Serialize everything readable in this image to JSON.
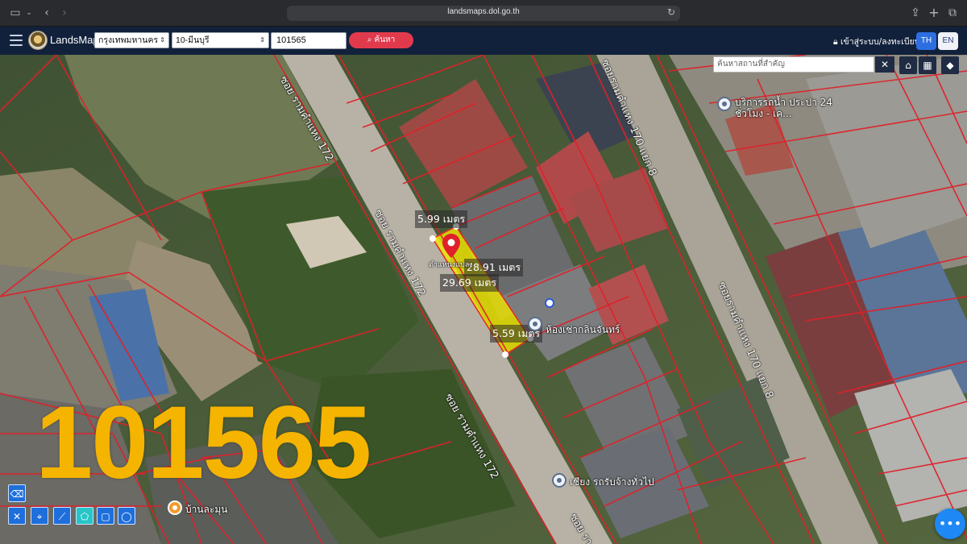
{
  "browser": {
    "url": "landsmaps.dol.go.th",
    "icons": [
      "sidebar-icon",
      "chevron-down-icon",
      "back-icon",
      "forward-icon",
      "reload-icon",
      "share-icon",
      "new-tab-icon",
      "tabs-icon"
    ]
  },
  "toolbar": {
    "brand": "LandsMaps",
    "province": "กรุงเทพมหานคร",
    "district": "10-มีนบุรี",
    "parcel_number": "101565",
    "search_label": "ค้นหา",
    "login_label": "เข้าสู่ระบบ/ลงทะเบียน",
    "lang_th": "TH",
    "lang_en": "EN"
  },
  "map": {
    "poi_search_placeholder": "ค้นหาสถานที่สำคัญ",
    "clear_label": "✕",
    "road_labels": {
      "soi_ramkhamhaeng_172_top": "ซอย รามคำแหง 172",
      "soi_ramkhamhaeng_172_mid": "ซอย รามคำแหง 172",
      "soi_ramkhamhaeng_172_low": "ซอย รามคำแหง 172",
      "soi_ramkhamhaeng_172_bottom": "ซอย รา",
      "soi_170_8_top": "ซอยรามคำแหง 170 แยก 8",
      "soi_170_8_right": "ซอยรามคำแหง 170 แยก 8"
    },
    "measurements": {
      "top": "5.99 เมตร",
      "side_right": "28.91 เมตร",
      "side_left": "29.69 เมตร",
      "bottom": "5.59 เมตร"
    },
    "marker_caption": "ตำแหน่งแปลง",
    "pois": {
      "water_service": "บริการรถน้ำ ประปา 24 ชั่วโมง - เค...",
      "rental_room": "ห้องเช่ากลิ่นจันทร์",
      "car_rental": "เชียง รถรับจ้างทั่วไป",
      "baan_lamun": "บ้านละมุน"
    },
    "parcel_number_overlay": "101565",
    "colors": {
      "parcel_fill": "#f2e900",
      "parcel_lines": "#e0202a",
      "number_overlay": "#f5b400",
      "marker": "#e0202a"
    },
    "tools": [
      "eraser-icon",
      "ruler-icon",
      "pin-icon",
      "line-measure-icon",
      "polygon-icon",
      "rectangle-icon",
      "circle-icon"
    ],
    "map_controls": [
      "home-icon",
      "grid-icon",
      "layers-icon"
    ]
  }
}
